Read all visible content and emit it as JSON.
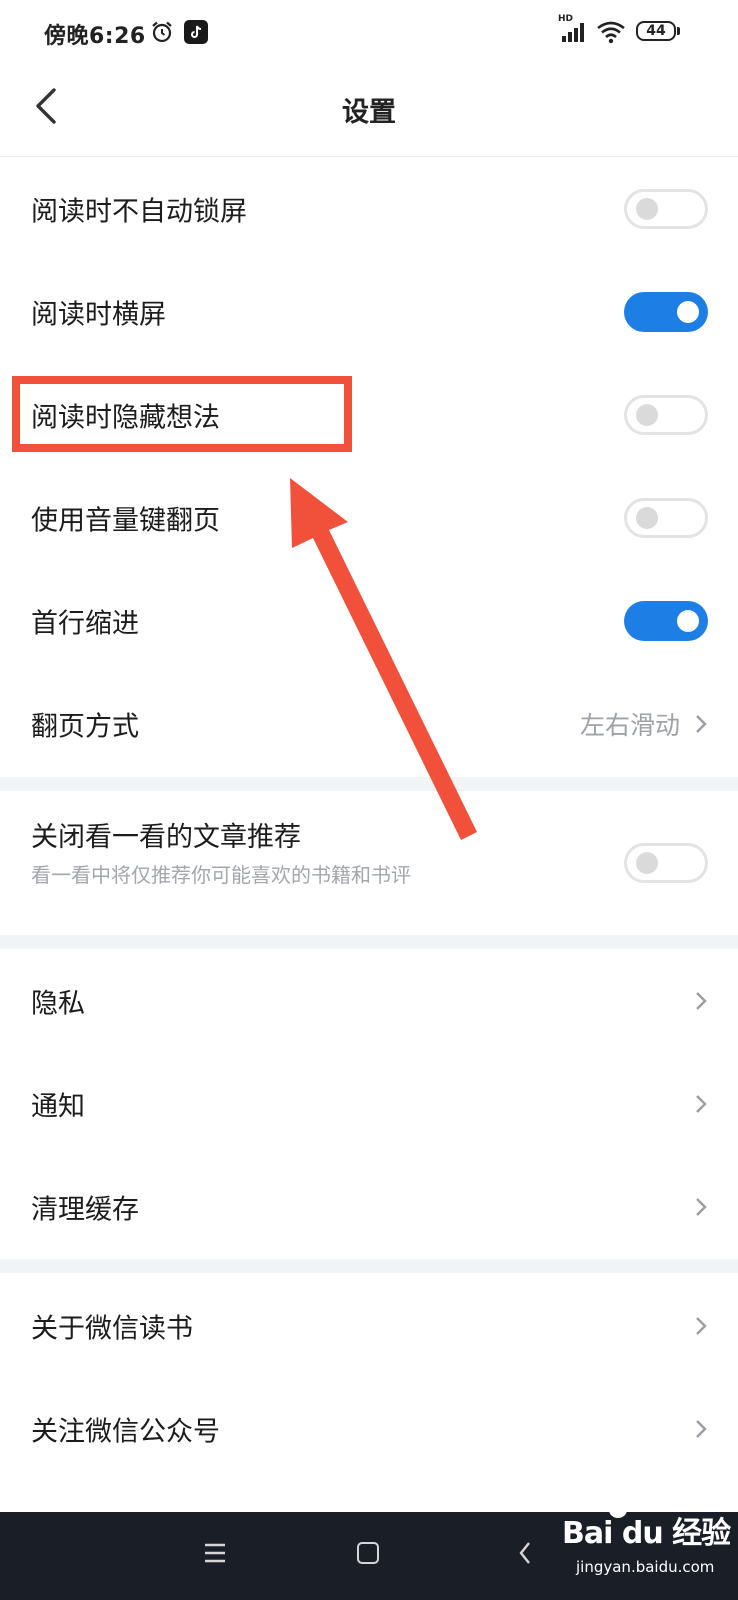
{
  "status_bar": {
    "time": "傍晚6:26",
    "network_label": "HD",
    "battery": "44"
  },
  "header": {
    "title": "设置"
  },
  "reading_settings": [
    {
      "label": "阅读时不自动锁屏",
      "toggle": "off"
    },
    {
      "label": "阅读时横屏",
      "toggle": "on"
    },
    {
      "label": "阅读时隐藏想法",
      "toggle": "off"
    },
    {
      "label": "使用音量键翻页",
      "toggle": "off"
    },
    {
      "label": "首行缩进",
      "toggle": "on"
    },
    {
      "label": "翻页方式",
      "value": "左右滑动"
    }
  ],
  "recommend_setting": {
    "label": "关闭看一看的文章推荐",
    "description": "看一看中将仅推荐你可能喜欢的书籍和书评",
    "toggle": "off"
  },
  "general_settings": [
    {
      "label": "隐私"
    },
    {
      "label": "通知"
    },
    {
      "label": "清理缓存"
    }
  ],
  "about_settings": [
    {
      "label": "关于微信读书"
    },
    {
      "label": "关注微信公众号"
    }
  ],
  "watermark": {
    "brand": "Bai du 经验",
    "site": "jingyan.baidu.com"
  },
  "colors": {
    "toggle_on": "#1d7fe6",
    "annotation": "#f1513a",
    "nav_bar": "#1a1e27"
  }
}
